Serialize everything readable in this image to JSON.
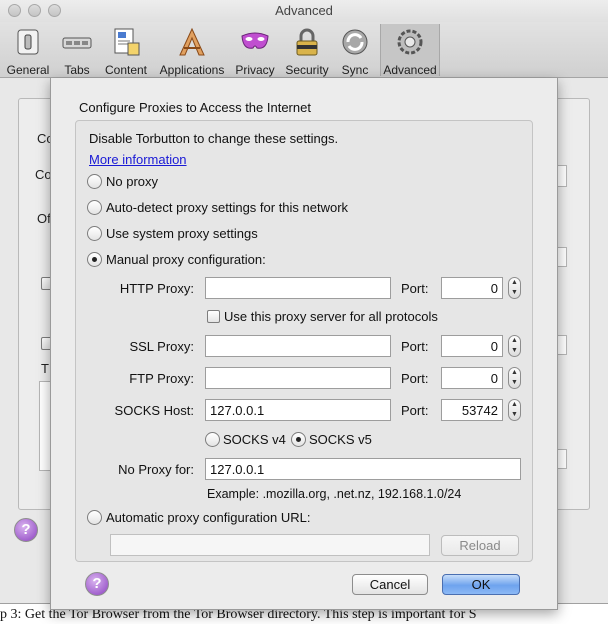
{
  "window": {
    "title": "Advanced",
    "toolbar": [
      {
        "label": "General",
        "icon": "general-switch-icon"
      },
      {
        "label": "Tabs",
        "icon": "tabs-icon"
      },
      {
        "label": "Content",
        "icon": "content-page-icon"
      },
      {
        "label": "Applications",
        "icon": "applications-icon"
      },
      {
        "label": "Privacy",
        "icon": "privacy-mask-icon"
      },
      {
        "label": "Security",
        "icon": "security-lock-icon"
      },
      {
        "label": "Sync",
        "icon": "sync-icon"
      },
      {
        "label": "Advanced",
        "icon": "advanced-gear-icon",
        "selected": true
      }
    ],
    "pane_fragments": [
      "Co",
      "Co",
      "Of",
      "T"
    ]
  },
  "dialog": {
    "title": "Configure Proxies to Access the Internet",
    "notice": "Disable Torbutton to change these settings.",
    "more_info_link": "More information",
    "options": {
      "no_proxy": "No proxy",
      "auto_detect": "Auto-detect proxy settings for this network",
      "system": "Use system proxy settings",
      "manual": "Manual proxy configuration:",
      "auto_url": "Automatic proxy configuration URL:"
    },
    "selected_option": "manual",
    "http": {
      "label": "HTTP Proxy:",
      "host": "",
      "port_label": "Port:",
      "port": "0"
    },
    "same_for_all": {
      "label": "Use this proxy server for all protocols",
      "checked": false
    },
    "ssl": {
      "label": "SSL Proxy:",
      "host": "",
      "port_label": "Port:",
      "port": "0"
    },
    "ftp": {
      "label": "FTP Proxy:",
      "host": "",
      "port_label": "Port:",
      "port": "0"
    },
    "socks": {
      "label": "SOCKS Host:",
      "host": "127.0.0.1",
      "port_label": "Port:",
      "port": "53742"
    },
    "socks_version": {
      "v4": "SOCKS v4",
      "v5": "SOCKS v5",
      "selected": "v5"
    },
    "no_proxy_for": {
      "label": "No Proxy for:",
      "value": "127.0.0.1"
    },
    "example": "Example: .mozilla.org, .net.nz, 192.168.1.0/24",
    "auto_url_value": "",
    "reload_label": "Reload",
    "cancel_label": "Cancel",
    "ok_label": "OK"
  },
  "help_glyph": "?",
  "caption": "p 3: Get the Tor Browser from the Tor Browser directory. This step is important for S"
}
